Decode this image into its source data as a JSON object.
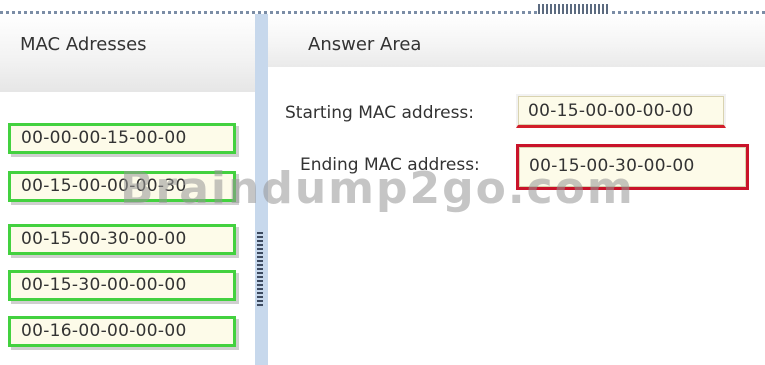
{
  "left_panel": {
    "title": "MAC Adresses",
    "items": [
      "00-00-00-15-00-00",
      "00-15-00-00-00-30",
      "00-15-00-30-00-00",
      "00-15-30-00-00-00",
      "00-16-00-00-00-00"
    ]
  },
  "right_panel": {
    "title": "Answer Area",
    "start_label": "Starting MAC address:",
    "start_value": "00-15-00-00-00-00",
    "end_label": "Ending MAC address:",
    "end_value": "00-15-00-30-00-00"
  },
  "watermark": "Braindump2go.com",
  "colors": {
    "item_border": "#43d13f",
    "slot_border_start": "#d21e2a",
    "slot_border_end": "#c9132a",
    "splitter": "#c7d8ec",
    "item_background": "#fdfbe9"
  }
}
